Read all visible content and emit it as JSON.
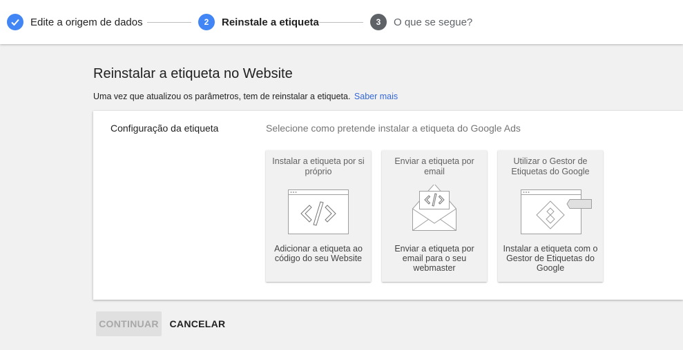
{
  "stepper": {
    "steps": [
      {
        "number": "",
        "label": "Edite a origem de dados",
        "state": "completed"
      },
      {
        "number": "2",
        "label": "Reinstale a etiqueta",
        "state": "active"
      },
      {
        "number": "3",
        "label": "O que se segue?",
        "state": "upcoming"
      }
    ]
  },
  "page": {
    "title": "Reinstalar a etiqueta no Website",
    "description": "Uma vez que atualizou os parâmetros, tem de reinstalar a etiqueta.",
    "learn_more": "Saber mais"
  },
  "card": {
    "section_label": "Configuração da etiqueta",
    "section_hint": "Selecione como pretende instalar a etiqueta do Google Ads",
    "options": [
      {
        "title": "Instalar a etiqueta por si próprio",
        "description": "Adicionar a etiqueta ao código do seu Website",
        "icon": "code-window-icon"
      },
      {
        "title": "Enviar a etiqueta por email",
        "description": "Enviar a etiqueta por email para o seu webmaster",
        "icon": "email-code-icon"
      },
      {
        "title": "Utilizar o Gestor de Etiquetas do Google",
        "description": "Instalar a etiqueta com o Gestor de Etiquetas do Google",
        "icon": "tag-manager-icon"
      }
    ]
  },
  "actions": {
    "continue_label": "CONTINUAR",
    "cancel_label": "CANCELAR"
  },
  "colors": {
    "accent": "#4285f4",
    "link": "#3367d6",
    "inactive_step": "#5f6368"
  }
}
